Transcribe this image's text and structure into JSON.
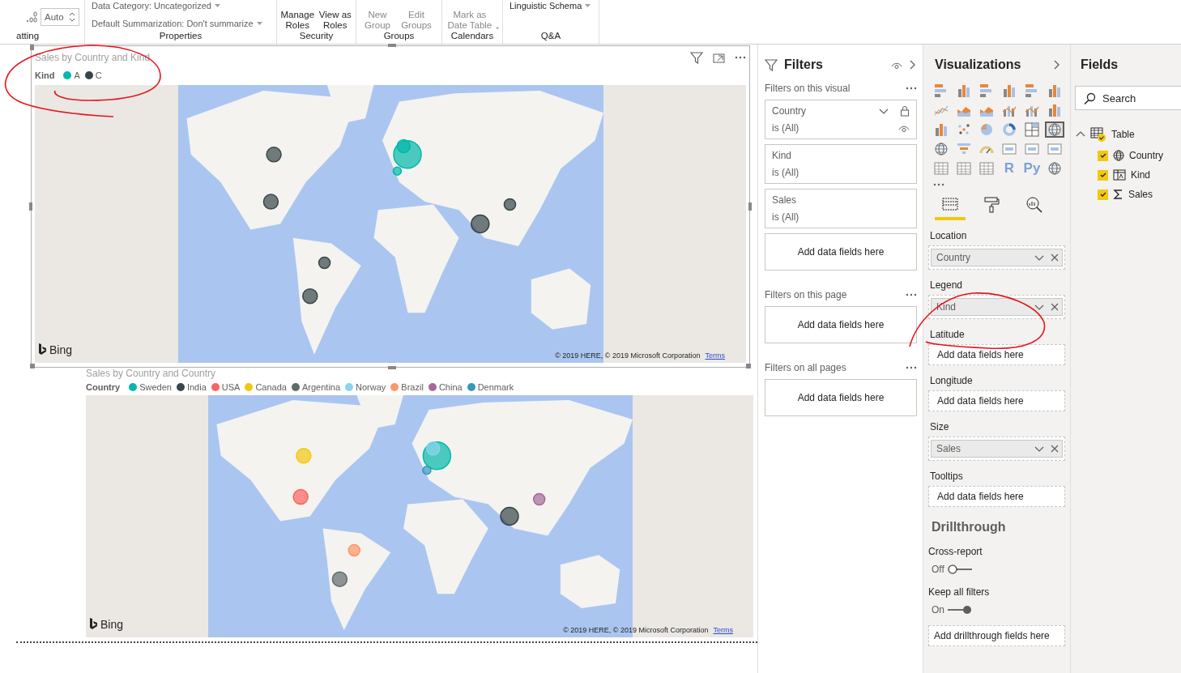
{
  "ribbon": {
    "groups": [
      {
        "kind": "spinner",
        "label": "atting",
        "spinner": {
          "value": "Auto"
        }
      },
      {
        "kind": "lines",
        "label": "Properties",
        "lines": [
          {
            "text": "Data Category: Uncategorized",
            "dropdown": true
          },
          {
            "text": "Default Summarization: Don't summarize",
            "dropdown": true
          }
        ]
      },
      {
        "kind": "buttons",
        "label": "Security",
        "buttons": [
          {
            "text": "Manage Roles",
            "disabled": false,
            "dropdown": false
          },
          {
            "text": "View as Roles",
            "disabled": false,
            "dropdown": false
          }
        ]
      },
      {
        "kind": "buttons",
        "label": "Groups",
        "buttons": [
          {
            "text": "New Group",
            "disabled": true,
            "dropdown": false
          },
          {
            "text": "Edit Groups",
            "disabled": true,
            "dropdown": false
          }
        ]
      },
      {
        "kind": "buttons",
        "label": "Calendars",
        "buttons": [
          {
            "text": "Mark as Date Table",
            "disabled": true,
            "dropdown": true
          }
        ]
      },
      {
        "kind": "lines",
        "label": "Q&A",
        "lines": [
          {
            "text": "Linguistic Schema",
            "dropdown": true
          }
        ]
      }
    ]
  },
  "visuals": [
    {
      "title": "Sales by Country and Kind",
      "selected": true,
      "legend": {
        "title": "Kind",
        "items": [
          {
            "label": "A",
            "color": "#01b8aa"
          },
          {
            "label": "C",
            "color": "#374649"
          }
        ]
      },
      "map": {
        "kind": "picture",
        "provider": "Bing",
        "attribution": "© 2019 HERE, © 2019 Microsoft Corporation",
        "terms": "Terms"
      }
    },
    {
      "title": "Sales by Country and Country",
      "selected": false,
      "legend": {
        "title": "Country",
        "items": [
          {
            "label": "Sweden",
            "color": "#01b8aa"
          },
          {
            "label": "India",
            "color": "#374649"
          },
          {
            "label": "USA",
            "color": "#fd625e"
          },
          {
            "label": "Canada",
            "color": "#f2c80f"
          },
          {
            "label": "Argentina",
            "color": "#5f6b6d"
          },
          {
            "label": "Norway",
            "color": "#8ad4eb"
          },
          {
            "label": "Brazil",
            "color": "#fe9666"
          },
          {
            "label": "China",
            "color": "#a66999"
          },
          {
            "label": "Denmark",
            "color": "#3599b8"
          }
        ]
      },
      "map": {
        "kind": "picture",
        "provider": "Bing",
        "attribution": "© 2019 HERE, © 2019 Microsoft Corporation",
        "terms": "Terms"
      }
    }
  ],
  "annotations": [
    {
      "kind": "ellipse"
    },
    {
      "kind": "ellipse"
    }
  ],
  "filters": {
    "title": "Filters",
    "sections": [
      {
        "title": "Filters on this visual",
        "cards": [
          {
            "field": "Country",
            "condition": "is (All)",
            "hovered": true
          },
          {
            "field": "Kind",
            "condition": "is (All)",
            "hovered": false
          },
          {
            "field": "Sales",
            "condition": "is (All)",
            "hovered": false
          }
        ],
        "placeholder": "Add data fields here"
      },
      {
        "title": "Filters on this page",
        "placeholder": "Add data fields here"
      },
      {
        "title": "Filters on all pages",
        "placeholder": "Add data fields here"
      }
    ]
  },
  "visualizations": {
    "title": "Visualizations",
    "types": [
      {
        "kind": "bar",
        "selected": false
      },
      {
        "kind": "column",
        "selected": false
      },
      {
        "kind": "bar",
        "selected": false
      },
      {
        "kind": "column",
        "selected": false
      },
      {
        "kind": "bar",
        "selected": false
      },
      {
        "kind": "column",
        "selected": false
      },
      {
        "kind": "line",
        "selected": false
      },
      {
        "kind": "area",
        "selected": false
      },
      {
        "kind": "area",
        "selected": false
      },
      {
        "kind": "combo",
        "selected": false
      },
      {
        "kind": "combo",
        "selected": false
      },
      {
        "kind": "column",
        "selected": false
      },
      {
        "kind": "column",
        "selected": false
      },
      {
        "kind": "scatter",
        "selected": false
      },
      {
        "kind": "pie",
        "selected": false
      },
      {
        "kind": "donut",
        "selected": false
      },
      {
        "kind": "treemap",
        "selected": false
      },
      {
        "kind": "map",
        "selected": true
      },
      {
        "kind": "map",
        "selected": false
      },
      {
        "kind": "funnel",
        "selected": false
      },
      {
        "kind": "gauge",
        "selected": false
      },
      {
        "kind": "card",
        "selected": false
      },
      {
        "kind": "card",
        "selected": false
      },
      {
        "kind": "card",
        "selected": false
      },
      {
        "kind": "table",
        "selected": false
      },
      {
        "kind": "table",
        "selected": false
      },
      {
        "kind": "table",
        "selected": false
      },
      {
        "kind": "label",
        "label": "R",
        "selected": false
      },
      {
        "kind": "label",
        "label": "Py",
        "selected": false
      },
      {
        "kind": "map",
        "selected": false
      }
    ],
    "tabs": [
      {
        "kind": "fields",
        "selected": true
      },
      {
        "kind": "format",
        "selected": false
      },
      {
        "kind": "analytics",
        "selected": false
      }
    ],
    "wells": [
      {
        "label": "Location",
        "value": "Country"
      },
      {
        "label": "Legend",
        "value": "Kind"
      },
      {
        "label": "Latitude",
        "placeholder": "Add data fields here"
      },
      {
        "label": "Longitude",
        "placeholder": "Add data fields here"
      },
      {
        "label": "Size",
        "value": "Sales"
      },
      {
        "label": "Tooltips",
        "placeholder": "Add data fields here"
      }
    ],
    "drillthrough": {
      "title": "Drillthrough",
      "toggles": [
        {
          "label": "Cross-report",
          "state_text": "Off",
          "on": false
        },
        {
          "label": "Keep all filters",
          "state_text": "On",
          "on": true
        }
      ],
      "placeholder": "Add drillthrough fields here"
    }
  },
  "fields": {
    "title": "Fields",
    "search": {
      "placeholder": "Search"
    },
    "tables": [
      {
        "name": "Table",
        "expanded": true,
        "in_use": true,
        "children": [
          {
            "name": "Country",
            "kind": "geography",
            "checked": true
          },
          {
            "name": "Kind",
            "kind": "calculated",
            "checked": true
          },
          {
            "name": "Sales",
            "kind": "measure",
            "checked": true
          }
        ]
      }
    ]
  }
}
